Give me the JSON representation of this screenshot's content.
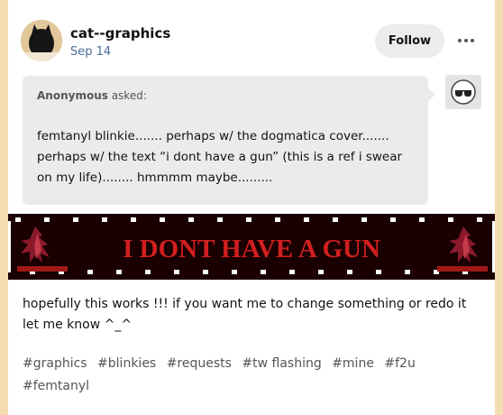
{
  "post": {
    "username": "cat--graphics",
    "date": "Sep 14",
    "follow_label": "Follow",
    "more_icon": "more-dots-icon",
    "ask": {
      "asker": "Anonymous",
      "asked_suffix": " asked:",
      "question": "femtanyl blinkie....... perhaps w/ the dogmatica cover....... perhaps w/ the text “i dont have a gun” (this is a ref i swear on my life)........ hmmmm maybe........."
    },
    "blinkie": {
      "text": "I DONT HAVE A GUN",
      "text_color": "#d21f1f",
      "background_color": "#1a0000"
    },
    "answer": "hopefully this works !!! if you want me to change something or redo it let me know ^_^",
    "tags": [
      "#graphics",
      "#blinkies",
      "#requests",
      "#tw flashing",
      "#mine",
      "#f2u",
      "#femtanyl"
    ]
  },
  "colors": {
    "page_background": "#f3dcb0",
    "card_background": "#ffffff",
    "date_color": "#4b6c95",
    "ask_background": "#ebebeb"
  }
}
